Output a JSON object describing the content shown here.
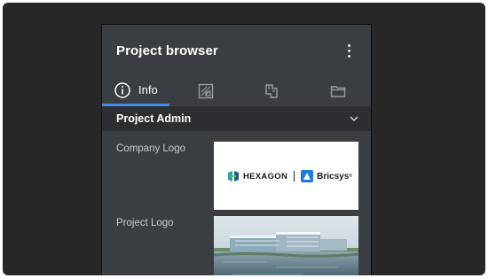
{
  "panel": {
    "title": "Project browser",
    "menu_icon": "more-vertical-icon"
  },
  "tabs": [
    {
      "label": "Info",
      "icon": "info-icon",
      "active": true
    },
    {
      "label": "",
      "icon": "drawing-sheet-icon",
      "active": false
    },
    {
      "label": "",
      "icon": "floor-plan-icon",
      "active": false
    },
    {
      "label": "",
      "icon": "folder-icon",
      "active": false
    }
  ],
  "section": {
    "title": "Project Admin",
    "icon": "chevron-down-icon",
    "expanded": true
  },
  "fields": {
    "company_logo_label": "Company Logo",
    "project_logo_label": "Project Logo"
  },
  "company_logo": {
    "brand1": "HEXAGON",
    "brand2": "Bricsys",
    "reg": "®"
  },
  "colors": {
    "accent": "#3f8ee8",
    "panel_bg": "#3a3d41",
    "section_bg": "#2c2e31",
    "outer_bg": "#272727"
  }
}
